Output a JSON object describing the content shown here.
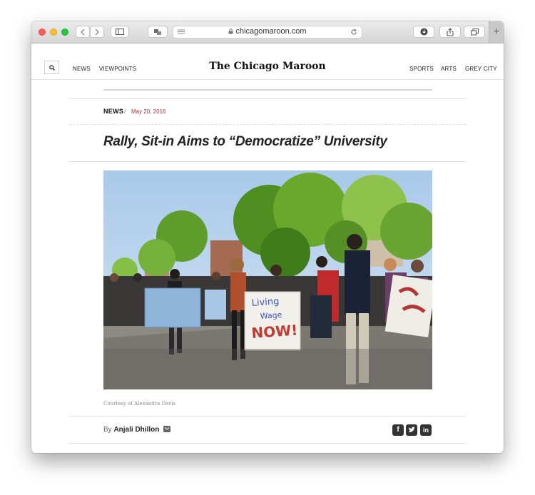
{
  "browser": {
    "url": "chicagomaroon.com",
    "new_tab": "+"
  },
  "site": {
    "masthead": "The Chicago Maroon",
    "nav_left": [
      "NEWS",
      "VIEWPOINTS"
    ],
    "nav_right": [
      "SPORTS",
      "ARTS",
      "GREY CITY"
    ]
  },
  "article": {
    "section": "NEWS",
    "separator": "/",
    "date": "May 20, 2016",
    "headline": "Rally, Sit-in Aims to “Democratize” University",
    "photo_signs": [
      "Living",
      "Wage",
      "NOW!"
    ],
    "caption": "Courtesy of Alexandra Davis",
    "byline_prefix": "By",
    "author": "Anjali Dhillon"
  },
  "social": [
    "facebook",
    "twitter",
    "linkedin"
  ],
  "colors": {
    "date_red": "#a33333",
    "text_dark": "#222222",
    "traffic_red": "#fe5f57",
    "traffic_yellow": "#febc2e",
    "traffic_green": "#28c840"
  }
}
